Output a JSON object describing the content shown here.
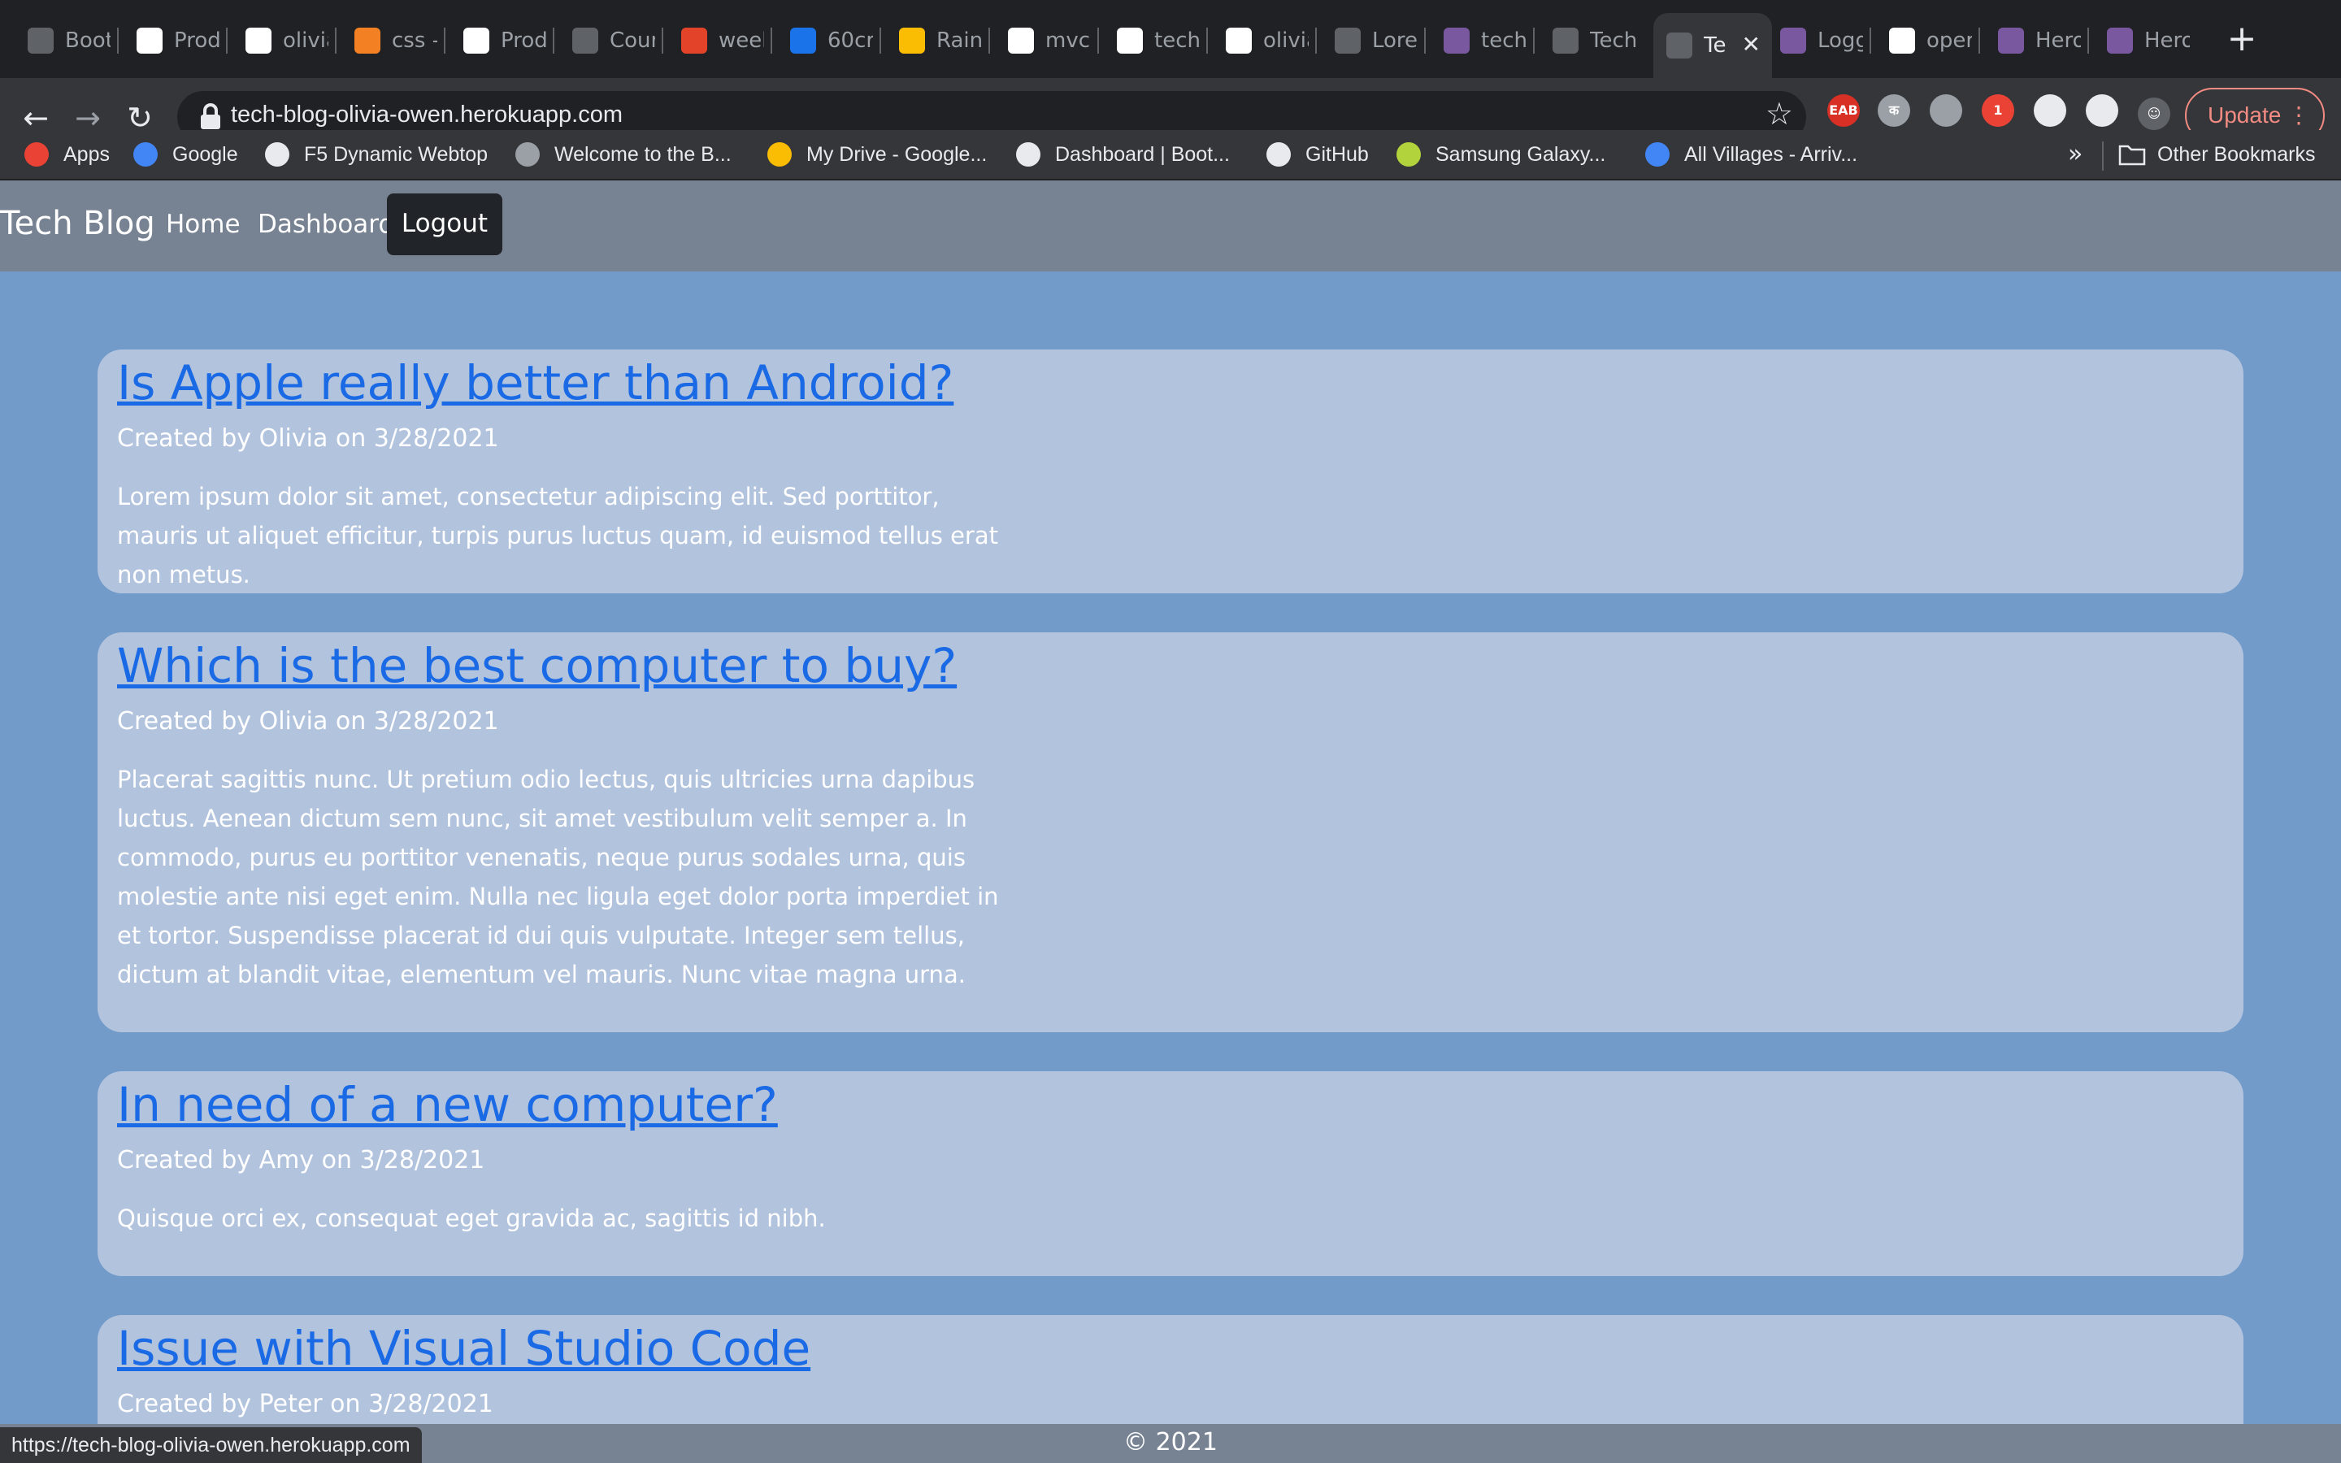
{
  "browser": {
    "tabs": [
      {
        "label": "Boot",
        "icon": "globe-icon",
        "color": "#5f6368"
      },
      {
        "label": "Prod",
        "icon": "product-icon",
        "color": "#ffffff"
      },
      {
        "label": "olivia",
        "icon": "github-icon",
        "color": "#ffffff"
      },
      {
        "label": "css -",
        "icon": "stackoverflow-icon",
        "color": "#f48024"
      },
      {
        "label": "Prod",
        "icon": "product-icon",
        "color": "#ffffff"
      },
      {
        "label": "Cour",
        "icon": "globe-icon",
        "color": "#5f6368"
      },
      {
        "label": "week",
        "icon": "gitlab-icon",
        "color": "#e24329"
      },
      {
        "label": "60cr",
        "icon": "on-icon",
        "color": "#1a73e8"
      },
      {
        "label": "Rain",
        "icon": "rainbow-icon",
        "color": "#fbbc04"
      },
      {
        "label": "mvc-",
        "icon": "github-icon",
        "color": "#ffffff"
      },
      {
        "label": "tech",
        "icon": "github-icon",
        "color": "#ffffff"
      },
      {
        "label": "olivia",
        "icon": "github-icon",
        "color": "#ffffff"
      },
      {
        "label": "Lorei",
        "icon": "lorem-icon",
        "color": "#5f6368"
      },
      {
        "label": "tech",
        "icon": "heroku-icon",
        "color": "#79589f"
      },
      {
        "label": "Tech",
        "icon": "globe-icon",
        "color": "#5f6368"
      },
      {
        "label": "Te",
        "icon": "globe-icon",
        "color": "#5f6368",
        "active": true
      },
      {
        "label": "Logg",
        "icon": "heroku-icon",
        "color": "#79589f"
      },
      {
        "label": "oper",
        "icon": "google-icon",
        "color": "#ffffff"
      },
      {
        "label": "Hero",
        "icon": "heroku-icon",
        "color": "#79589f"
      },
      {
        "label": "Hero",
        "icon": "heroku-icon",
        "color": "#79589f"
      }
    ],
    "url": "tech-blog-olivia-owen.herokuapp.com",
    "update_label": "Update",
    "extensions": [
      {
        "name": "eab-extension-icon",
        "text": "EAB",
        "color": "#d93025"
      },
      {
        "name": "hindi-extension-icon",
        "text": "क",
        "color": "#9aa0a6"
      },
      {
        "name": "chat-extension-icon",
        "text": "",
        "color": "#9aa0a6"
      },
      {
        "name": "screencast-extension-icon",
        "text": "1",
        "color": "#ea4335"
      },
      {
        "name": "dark-extension-icon",
        "text": "",
        "color": "#e8eaed"
      },
      {
        "name": "puzzle-extensions-icon",
        "text": "",
        "color": "#e8eaed"
      }
    ],
    "bookmarks": [
      {
        "label": "Apps",
        "icon": "apps-grid-icon",
        "color": "#ea4335"
      },
      {
        "label": "Google",
        "icon": "google-icon",
        "color": "#4285f4"
      },
      {
        "label": "F5 Dynamic Webtop",
        "icon": "document-icon",
        "color": "#e8eaed"
      },
      {
        "label": "Welcome to the B...",
        "icon": "book-icon",
        "color": "#9aa0a6"
      },
      {
        "label": "My Drive - Google...",
        "icon": "drive-icon",
        "color": "#fbbc04"
      },
      {
        "label": "Dashboard | Boot...",
        "icon": "globe-icon",
        "color": "#e8eaed"
      },
      {
        "label": "GitHub",
        "icon": "github-icon",
        "color": "#e8eaed"
      },
      {
        "label": "Samsung Galaxy...",
        "icon": "samsung-icon",
        "color": "#b3d33c"
      },
      {
        "label": "All Villages - Arriv...",
        "icon": "star-outline-icon",
        "color": "#4285f4"
      }
    ],
    "other_bookmarks": "Other Bookmarks",
    "status_url": "https://tech-blog-olivia-owen.herokuapp.com"
  },
  "site": {
    "brand": "Tech Blog",
    "nav": {
      "home": "Home",
      "dashboard": "Dashboard",
      "logout": "Logout"
    },
    "posts": [
      {
        "title": "Is Apple really better than Android?",
        "meta": "Created by Olivia on 3/28/2021",
        "body": "Lorem ipsum dolor sit amet, consectetur adipiscing elit. Sed porttitor, mauris ut aliquet efficitur, turpis purus luctus quam, id euismod tellus erat non metus."
      },
      {
        "title": "Which is the best computer to buy?",
        "meta": "Created by Olivia on 3/28/2021",
        "body": "Placerat sagittis nunc. Ut pretium odio lectus, quis ultricies urna dapibus luctus. Aenean dictum sem nunc, sit amet vestibulum velit semper a. In commodo, purus eu porttitor venenatis, neque purus sodales urna, quis molestie ante nisi eget enim. Nulla nec ligula eget dolor porta imperdiet in et tortor. Suspendisse placerat id dui quis vulputate. Integer sem tellus, dictum at blandit vitae, elementum vel mauris. Nunc vitae magna urna."
      },
      {
        "title": "In need of a new computer?",
        "meta": "Created by Amy on 3/28/2021",
        "body": "Quisque orci ex, consequat eget gravida ac, sagittis id nibh."
      },
      {
        "title": "Issue with Visual Studio Code",
        "meta": "Created by Peter on 3/28/2021",
        "body": ""
      }
    ],
    "footer": "© 2021"
  }
}
